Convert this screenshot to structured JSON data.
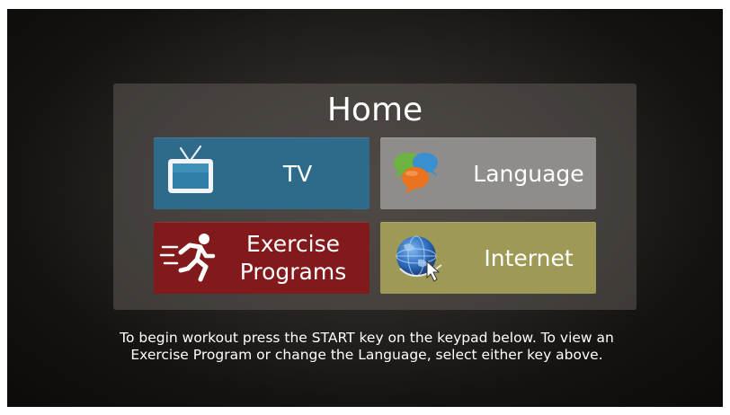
{
  "home": {
    "title": "Home"
  },
  "tiles": {
    "tv": {
      "label": "TV",
      "icon": "tv-icon",
      "color": "#2e6b8a"
    },
    "language": {
      "label": "Language",
      "icon": "speech-bubbles-icon",
      "color": "#8f8d8a"
    },
    "exercise": {
      "label_line1": "Exercise",
      "label_line2": "Programs",
      "icon": "running-person-icon",
      "color": "#821a1c"
    },
    "internet": {
      "label": "Internet",
      "icon": "globe-cursor-icon",
      "color": "#9e9a56"
    }
  },
  "instructions": {
    "line1": "To begin workout press the START key on the keypad below. To view an",
    "line2": "Exercise Program or change the Language, select either key above."
  }
}
